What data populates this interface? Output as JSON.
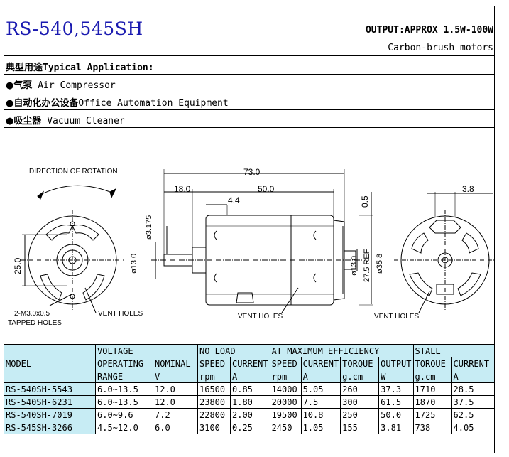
{
  "header": {
    "model_title": "RS-540,545SH",
    "output_text": "OUTPUT:APPROX 1.5W-100W",
    "motor_type": "Carbon-brush motors"
  },
  "applications": {
    "heading_cn": "典型用途",
    "heading_en": "Typical Application:",
    "items": [
      {
        "cn": "气泵",
        "en": "Air Compressor"
      },
      {
        "cn": "自动化办公设备",
        "en": "Office Automation Equipment"
      },
      {
        "cn": "吸尘器",
        "en": "Vacuum Cleaner"
      }
    ],
    "bullet": "●"
  },
  "drawing": {
    "direction_label": "DIRECTION OF ROTATION",
    "dim_total": "73.0",
    "dim_18": "18.0",
    "dim_50": "50.0",
    "dim_44": "4.4",
    "dim_05": "0.5",
    "dim_38": "3.8",
    "dim_shaft": "ø3.175",
    "dim_d13a": "ø13.0",
    "dim_d13b": "ø13.0",
    "dim_275": "27.5 REF",
    "dim_358": "ø35.8",
    "dim_25": "25.0",
    "tapped_line1": "2-M3.0x0.5",
    "tapped_line2": "TAPPED HOLES",
    "vent_left": "VENT HOLES",
    "vent_mid": "VENT HOLES",
    "vent_right": "VENT HOLES"
  },
  "table": {
    "headers_top": [
      "MODEL",
      "VOLTAGE",
      "NO LOAD",
      "AT MAXIMUM EFFICIENCY",
      "STALL"
    ],
    "headers_mid": [
      "OPERATING",
      "NOMINAL",
      "SPEED",
      "CURRENT",
      "SPEED",
      "CURRENT",
      "TORQUE",
      "OUTPUT",
      "TORQUE",
      "CURRENT"
    ],
    "headers_unit": [
      "RANGE",
      "V",
      "rpm",
      "A",
      "rpm",
      "A",
      "g.cm",
      "W",
      "g.cm",
      "A"
    ],
    "rows": [
      [
        "RS-540SH-5543",
        "6.0~13.5",
        "12.0",
        "16500",
        "0.85",
        "14000",
        "5.05",
        "260",
        "37.3",
        "1710",
        "28.5"
      ],
      [
        "RS-540SH-6231",
        "6.0~13.5",
        "12.0",
        "23800",
        "1.80",
        "20000",
        "7.5",
        "300",
        "61.5",
        "1870",
        "37.5"
      ],
      [
        "RS-540SH-7019",
        "6.0~9.6",
        "7.2",
        "22800",
        "2.00",
        "19500",
        "10.8",
        "250",
        "50.0",
        "1725",
        "62.5"
      ],
      [
        "RS-545SH-3266",
        "4.5~12.0",
        "6.0",
        "3100",
        "0.25",
        "2450",
        "1.05",
        "155",
        "3.81",
        "738",
        "4.05"
      ]
    ]
  },
  "colors": {
    "title": "#1a1ab0",
    "table_header_bg": "#c7ecf4"
  }
}
